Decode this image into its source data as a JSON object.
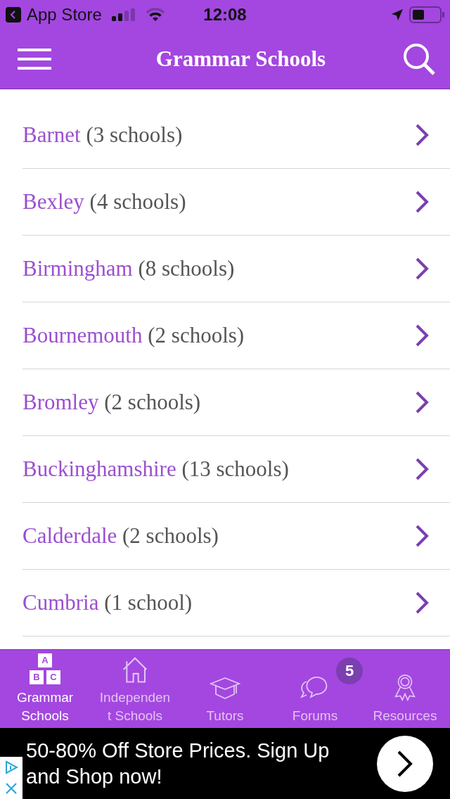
{
  "status_bar": {
    "back_app": "App Store",
    "time": "12:08"
  },
  "nav": {
    "title": "Grammar Schools"
  },
  "regions": [
    {
      "name": "Barnet",
      "count": "(3 schools)"
    },
    {
      "name": "Bexley",
      "count": "(4 schools)"
    },
    {
      "name": "Birmingham",
      "count": "(8 schools)"
    },
    {
      "name": "Bournemouth",
      "count": "(2 schools)"
    },
    {
      "name": "Bromley",
      "count": "(2 schools)"
    },
    {
      "name": "Buckinghamshire",
      "count": "(13 schools)"
    },
    {
      "name": "Calderdale",
      "count": "(2 schools)"
    },
    {
      "name": "Cumbria",
      "count": "(1 school)"
    }
  ],
  "tabs": [
    {
      "kind": "blocks",
      "label": "Grammar Schools",
      "icon_letters": [
        "A",
        "B",
        "C"
      ],
      "selected": true
    },
    {
      "kind": "house",
      "label": "Independent Schools",
      "selected": false
    },
    {
      "kind": "cap",
      "label": "Tutors",
      "selected": false
    },
    {
      "kind": "chat",
      "label": "Forums",
      "badge": "5",
      "selected": false
    },
    {
      "kind": "award",
      "label": "Resources",
      "selected": false
    }
  ],
  "ad": {
    "headline": "50-80% Off Store Prices. Sign Up and Shop now!"
  }
}
